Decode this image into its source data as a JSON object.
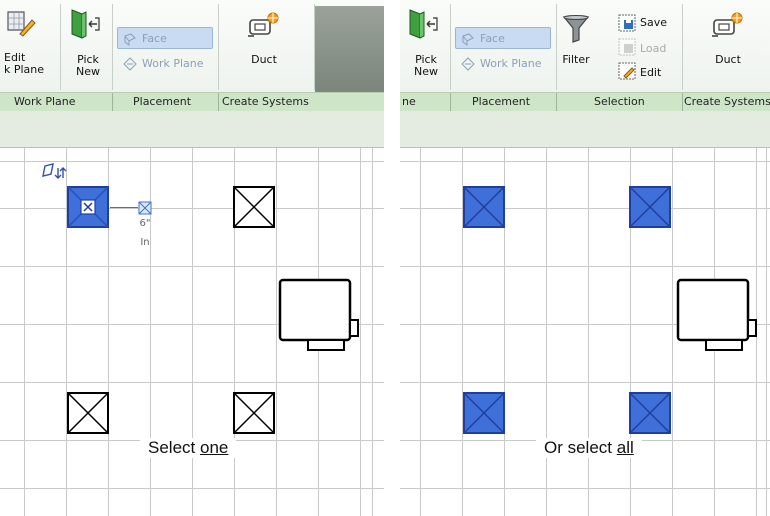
{
  "left_panel": {
    "ribbon": {
      "edit_work_plane_label_1": "Edit",
      "edit_work_plane_label_2": "k Plane",
      "pick_new_label_1": "Pick",
      "pick_new_label_2": "New",
      "face_label": "Face",
      "work_plane_label": "Work Plane",
      "duct_label": "Duct"
    },
    "groups": {
      "work_plane": "Work Plane",
      "placement": "Placement",
      "create_systems": "Create Systems"
    },
    "dimension": {
      "value": "6\"",
      "unit": "In"
    },
    "caption_prefix": "Select ",
    "caption_link": "one"
  },
  "right_panel": {
    "ribbon": {
      "pick_new_label_1": "Pick",
      "pick_new_label_2": "New",
      "face_label": "Face",
      "work_plane_label": "Work Plane",
      "filter_label": "Filter",
      "save_label": "Save",
      "load_label": "Load",
      "edit_label": "Edit",
      "duct_label": "Duct"
    },
    "groups": {
      "ne": "ne",
      "placement": "Placement",
      "selection": "Selection",
      "create_systems": "Create Systems"
    },
    "caption_prefix": "Or select ",
    "caption_link": "all"
  },
  "colors": {
    "selected_fill": "#3f6fd8",
    "band": "#cfe5c8",
    "grid": "#c9c9c9"
  }
}
